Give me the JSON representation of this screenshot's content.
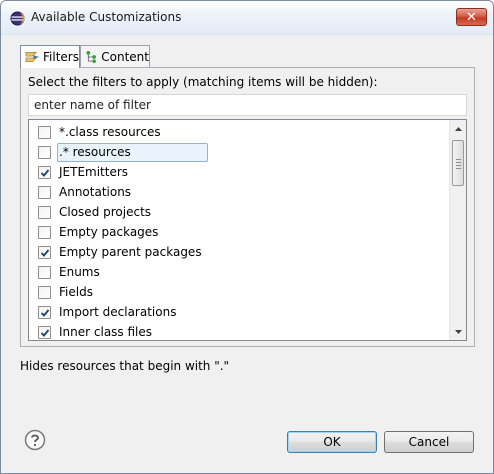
{
  "window": {
    "title": "Available Customizations",
    "close_label": "✕"
  },
  "tabs": [
    {
      "label": "Filters",
      "icon": "filter-icon",
      "active": true
    },
    {
      "label": "Content",
      "icon": "content-tree-icon",
      "active": false
    }
  ],
  "filters_tab": {
    "instruction": "Select the filters to apply (matching items will be hidden):",
    "search_placeholder": "enter name of filter",
    "items": [
      {
        "label": "*.class resources",
        "checked": false,
        "selected": false
      },
      {
        "label": ".* resources",
        "checked": false,
        "selected": true
      },
      {
        "label": "JETEmitters",
        "checked": true,
        "selected": false
      },
      {
        "label": "Annotations",
        "checked": false,
        "selected": false
      },
      {
        "label": "Closed projects",
        "checked": false,
        "selected": false
      },
      {
        "label": "Empty packages",
        "checked": false,
        "selected": false
      },
      {
        "label": "Empty parent packages",
        "checked": true,
        "selected": false
      },
      {
        "label": "Enums",
        "checked": false,
        "selected": false
      },
      {
        "label": "Fields",
        "checked": false,
        "selected": false
      },
      {
        "label": "Import declarations",
        "checked": true,
        "selected": false
      },
      {
        "label": "Inner class files",
        "checked": true,
        "selected": false
      }
    ]
  },
  "description": "Hides resources that begin with \".\"",
  "buttons": {
    "ok": "OK",
    "cancel": "Cancel"
  },
  "colors": {
    "window_bg": "#f0f0f0",
    "selection_border": "#8db2e3",
    "check": "#1b3f74"
  }
}
